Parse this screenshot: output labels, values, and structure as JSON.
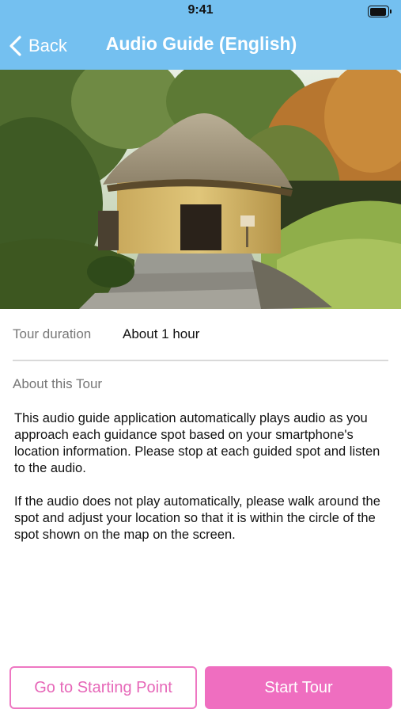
{
  "status_bar": {
    "time": "9:41"
  },
  "nav": {
    "back_label": "Back",
    "title": "Audio Guide (English)"
  },
  "hero": {
    "image": "thatched-hut-photo"
  },
  "tour": {
    "duration_label": "Tour duration",
    "duration_value": "About 1 hour"
  },
  "about": {
    "title": "About this Tour",
    "paragraphs": [
      "This audio guide application automatically plays audio as you approach each guidance spot based on your smartphone's location information. Please stop at each guided spot and listen to the audio.",
      "If the audio does not play automatically, please walk around the spot and adjust your location so that it is within the circle of the spot shown on the map on the screen."
    ]
  },
  "buttons": {
    "starting_point": "Go to Starting Point",
    "start_tour": "Start Tour"
  },
  "colors": {
    "nav_bar": "#74c0f0",
    "accent_pink": "#ef6ec0"
  }
}
